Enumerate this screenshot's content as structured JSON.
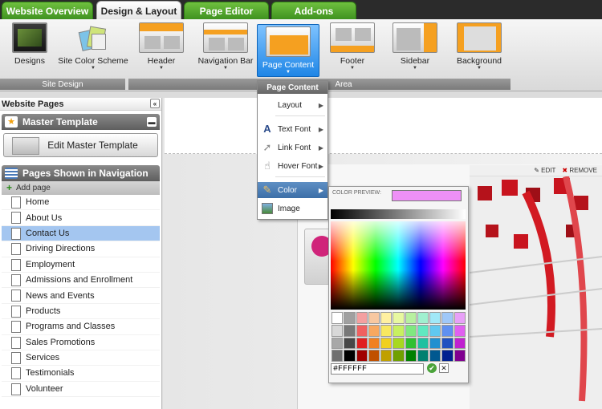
{
  "tabs": [
    {
      "label": "Website Overview"
    },
    {
      "label": "Design & Layout"
    },
    {
      "label": "Page Editor"
    },
    {
      "label": "Add-ons"
    }
  ],
  "ribbon": {
    "designs": "Designs",
    "site_color_scheme": "Site Color Scheme",
    "header": "Header",
    "navigation_bar": "Navigation Bar",
    "page_content": "Page Content",
    "footer": "Footer",
    "sidebar": "Sidebar",
    "background": "Background",
    "group_site_design": "Site Design",
    "group_area": "Area"
  },
  "dropdown": {
    "title": "Page Content",
    "items": [
      {
        "label": "Layout"
      },
      {
        "label": "Text Font"
      },
      {
        "label": "Link Font"
      },
      {
        "label": "Hover Font"
      },
      {
        "label": "Color"
      },
      {
        "label": "Image"
      }
    ]
  },
  "left_panel": {
    "title": "Website Pages",
    "master_section": "Master Template",
    "edit_master": "Edit Master Template",
    "nav_section": "Pages Shown in Navigation",
    "add_page": "Add page",
    "pages": [
      "Home",
      "About Us",
      "Contact Us",
      "Driving Directions",
      "Employment",
      "Admissions and Enrollment",
      "News and Events",
      "Products",
      "Programs and Classes",
      "Sales Promotions",
      "Services",
      "Testimonials",
      "Volunteer"
    ],
    "selected_page": "Contact Us"
  },
  "editbar": {
    "edit": "EDIT",
    "remove": "REMOVE"
  },
  "color_picker": {
    "preview_label": "COLOR PREVIEW:",
    "preview_color": "#ee90f6",
    "hex_value": "#FFFFFF",
    "swatches": [
      "#ffffff",
      "#a0a0a0",
      "#f4a0a0",
      "#f8c8a0",
      "#fff0a0",
      "#e8f8a0",
      "#b8f0a0",
      "#a0f0d0",
      "#a0e8f8",
      "#a0c8f8",
      "#e8a0f8",
      "#d8d8d8",
      "#787878",
      "#f06060",
      "#f8a860",
      "#f8e860",
      "#c8f060",
      "#80e880",
      "#60e8c0",
      "#60c8f0",
      "#6090f0",
      "#e060f0",
      "#a8a8a8",
      "#484848",
      "#e02020",
      "#f08020",
      "#f0d020",
      "#a8d820",
      "#30c030",
      "#20c0a0",
      "#2090d0",
      "#2050c0",
      "#c020d0",
      "#707070",
      "#000000",
      "#a00000",
      "#c05000",
      "#c0a000",
      "#70a000",
      "#008000",
      "#008070",
      "#005890",
      "#002090",
      "#800090"
    ]
  },
  "colors": {
    "tab_green": "#4aa32a",
    "ribbon_selected": "#1f86e6",
    "selected_row": "#a4c6f0"
  }
}
